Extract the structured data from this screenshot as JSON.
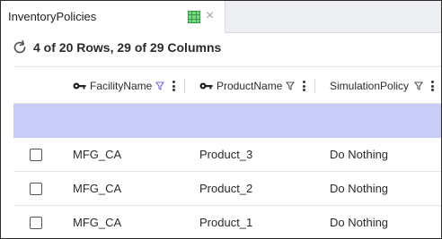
{
  "tab": {
    "title": "InventoryPolicies",
    "grid_icon": "grid-table-icon",
    "close_icon": "close-icon",
    "close_glyph": "×"
  },
  "toolbar": {
    "refresh_icon": "refresh-icon",
    "row_count_text": "4 of 20 Rows, 29 of 29 Columns"
  },
  "table": {
    "columns": [
      {
        "label": "FacilityName",
        "key": true
      },
      {
        "label": "ProductName",
        "key": true
      },
      {
        "label": "SimulationPolicy",
        "key": false
      }
    ],
    "rows": [
      [
        "MFG_CA",
        "Product_3",
        "Do Nothing"
      ],
      [
        "MFG_CA",
        "Product_2",
        "Do Nothing"
      ],
      [
        "MFG_CA",
        "Product_1",
        "Do Nothing"
      ]
    ]
  },
  "colors": {
    "selected_band": "#c9cdf6",
    "accent_green": "#2e9e3e",
    "filter_icon": "#7b6bd6"
  }
}
